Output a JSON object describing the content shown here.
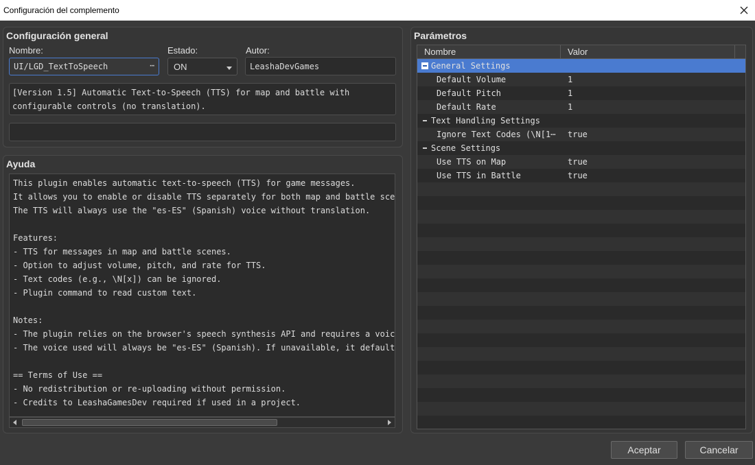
{
  "window": {
    "title": "Configuración del complemento"
  },
  "general": {
    "title": "Configuración general",
    "name_label": "Nombre:",
    "name_value": "UI/LGD_TextToSpeech",
    "name_dots": "⋯",
    "status_label": "Estado:",
    "status_value": "ON",
    "author_label": "Autor:",
    "author_value": "LeashaDevGames",
    "description_lines": [
      "[Version 1.5] Automatic Text-to-Speech (TTS) for map and battle with",
      "configurable controls (no translation)."
    ]
  },
  "help": {
    "title": "Ayuda",
    "lines": [
      "This plugin enables automatic text-to-speech (TTS) for game messages.",
      "It allows you to enable or disable TTS separately for both map and battle scene",
      "The TTS will always use the \"es-ES\" (Spanish) voice without translation.",
      "",
      "Features:",
      "- TTS for messages in map and battle scenes.",
      "- Option to adjust volume, pitch, and rate for TTS.",
      "- Text codes (e.g., \\N[x]) can be ignored.",
      "- Plugin command to read custom text.",
      "",
      "Notes:",
      "- The plugin relies on the browser's speech synthesis API and requires a voice",
      "- The voice used will always be \"es-ES\" (Spanish). If unavailable, it defaults",
      "",
      "== Terms of Use ==",
      "- No redistribution or re-uploading without permission.",
      "- Credits to LeashaGamesDev required if used in a project."
    ],
    "scroll_position": 0.0
  },
  "params": {
    "title": "Parámetros",
    "col_name": "Nombre",
    "col_value": "Valor",
    "rows": [
      {
        "name": "General Settings",
        "value": "",
        "group": true,
        "selected": true
      },
      {
        "name": "Default Volume",
        "value": "1",
        "group": false
      },
      {
        "name": "Default Pitch",
        "value": "1",
        "group": false
      },
      {
        "name": "Default Rate",
        "value": "1",
        "group": false
      },
      {
        "name": "Text Handling Settings",
        "value": "",
        "group": true
      },
      {
        "name": "Ignore Text Codes (\\N[1⋯",
        "value": "true",
        "group": false
      },
      {
        "name": "Scene Settings",
        "value": "",
        "group": true
      },
      {
        "name": "Use TTS on Map",
        "value": "true",
        "group": false
      },
      {
        "name": "Use TTS in Battle",
        "value": "true",
        "group": false
      }
    ]
  },
  "buttons": {
    "ok": "Aceptar",
    "cancel": "Cancelar"
  },
  "colors": {
    "accent": "#4a7bd0",
    "background": "#3a3a3a",
    "panel": "#363636",
    "field": "#2b2b2b"
  },
  "icons": {
    "close": "close-icon",
    "dropdown": "chevron-down-icon",
    "collapse": "minus-icon"
  }
}
